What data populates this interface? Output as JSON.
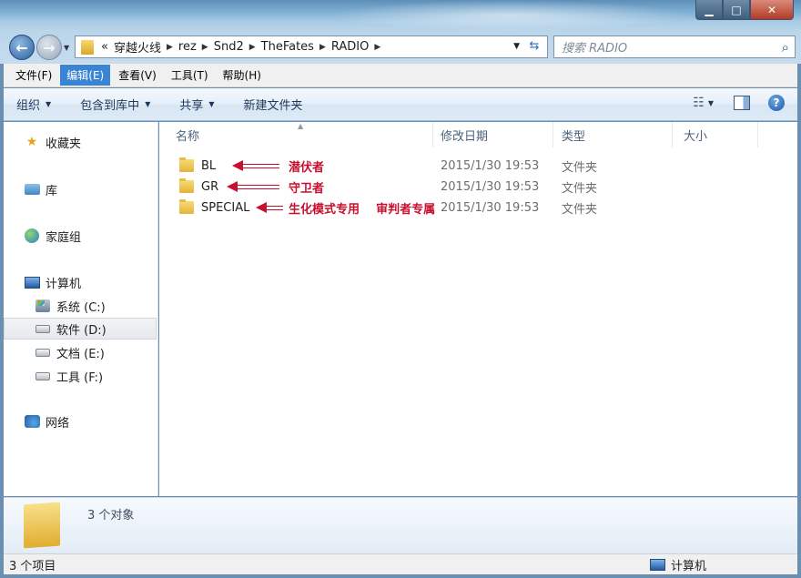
{
  "window": {
    "controls": {
      "minimize": "▁",
      "maximize": "□",
      "close": "✕"
    }
  },
  "address": {
    "prefix": "«",
    "breadcrumbs": [
      "穿越火线",
      "rez",
      "Snd2",
      "TheFates",
      "RADIO"
    ]
  },
  "search": {
    "placeholder": "搜索 RADIO"
  },
  "menu": [
    {
      "label": "文件(F)",
      "active": false
    },
    {
      "label": "编辑(E)",
      "active": true
    },
    {
      "label": "查看(V)",
      "active": false
    },
    {
      "label": "工具(T)",
      "active": false
    },
    {
      "label": "帮助(H)",
      "active": false
    }
  ],
  "commands": [
    {
      "label": "组织",
      "dropdown": true
    },
    {
      "label": "包含到库中",
      "dropdown": true
    },
    {
      "label": "共享",
      "dropdown": true
    },
    {
      "label": "新建文件夹",
      "dropdown": false
    }
  ],
  "nav": {
    "favorites": "收藏夹",
    "libraries": "库",
    "homegroup": "家庭组",
    "computer": "计算机",
    "drives": [
      {
        "label": "系统 (C:)",
        "selected": false
      },
      {
        "label": "软件 (D:)",
        "selected": true
      },
      {
        "label": "文档 (E:)",
        "selected": false
      },
      {
        "label": "工具 (F:)",
        "selected": false
      }
    ],
    "network": "网络"
  },
  "columns": {
    "name": "名称",
    "modified": "修改日期",
    "type": "类型",
    "size": "大小"
  },
  "files": [
    {
      "name": "BL",
      "modified": "2015/1/30 19:53",
      "type": "文件夹",
      "note": "潜伏者"
    },
    {
      "name": "GR",
      "modified": "2015/1/30 19:53",
      "type": "文件夹",
      "note": "守卫者"
    },
    {
      "name": "SPECIAL",
      "modified": "2015/1/30 19:53",
      "type": "文件夹",
      "note": "生化模式专用    审判者专属"
    }
  ],
  "details": {
    "summary": "3 个对象"
  },
  "status": {
    "count": "3 个项目",
    "location": "计算机"
  }
}
